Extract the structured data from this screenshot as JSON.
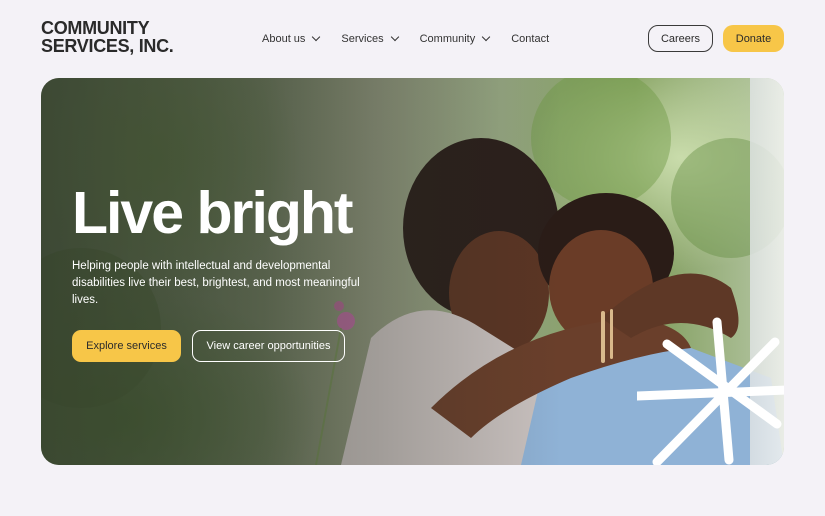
{
  "brand": {
    "line1": "COMMUNITY",
    "line2": "SERVICES, INC."
  },
  "nav": {
    "items": [
      {
        "label": "About us",
        "dropdown": true
      },
      {
        "label": "Services",
        "dropdown": true
      },
      {
        "label": "Community",
        "dropdown": true
      },
      {
        "label": "Contact",
        "dropdown": false
      }
    ],
    "careers_label": "Careers",
    "donate_label": "Donate"
  },
  "hero": {
    "title": "Live bright",
    "subtitle": "Helping people with intellectual and developmental disabilities live their best, brightest, and most meaningful lives.",
    "primary_cta": "Explore services",
    "secondary_cta": "View career opportunities",
    "image_icon": "photo-two-women-hugging"
  },
  "colors": {
    "accent": "#f7c648",
    "page_bg": "#f4f2f7",
    "text": "#2b2b2b"
  }
}
